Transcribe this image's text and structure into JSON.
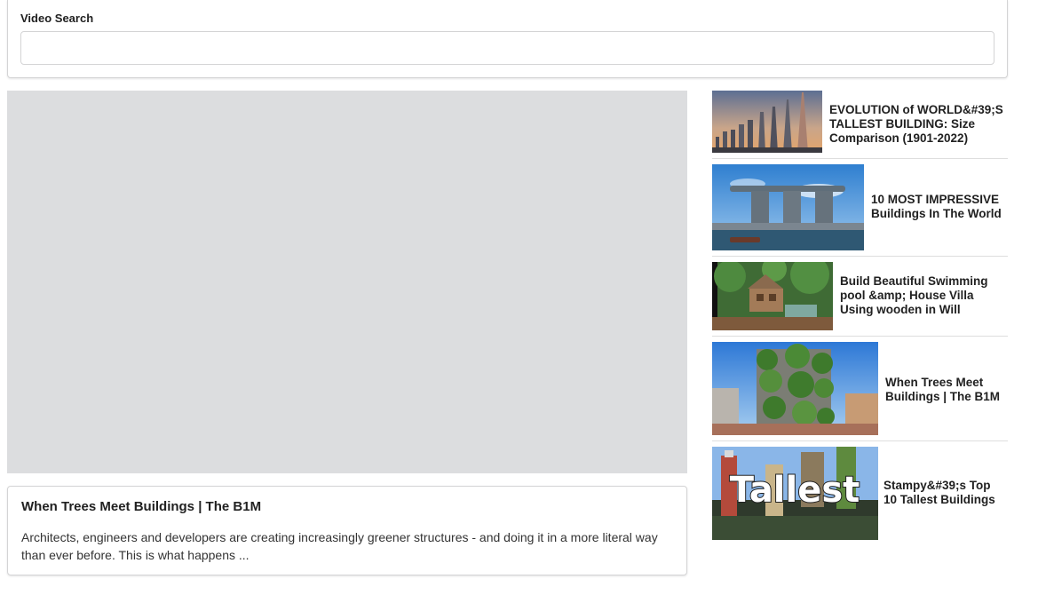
{
  "search": {
    "label": "Video Search",
    "value": "",
    "placeholder": ""
  },
  "selected_video": {
    "title": "When Trees Meet Buildings | The B1M",
    "description": "Architects, engineers and developers are creating increasingly greener structures - and doing it in a more literal way than ever before. This is what happens ..."
  },
  "video_list": [
    {
      "title": "EVOLUTION of WORLD&#39;S TALLEST BUILDING: Size Comparison (1901-2022)",
      "thumbnail": "skyscraper-comparison-thumbnail"
    },
    {
      "title": "10 MOST IMPRESSIVE Buildings In The World",
      "thumbnail": "marina-bay-sands-thumbnail"
    },
    {
      "title": "Build Beautiful Swimming pool &amp; House Villa Using wooden in Will",
      "thumbnail": "jungle-villa-thumbnail"
    },
    {
      "title": "When Trees Meet Buildings | The B1M",
      "thumbnail": "vertical-forest-thumbnail"
    },
    {
      "title": "Stampy&#39;s Top 10 Tallest Buildings",
      "thumbnail": "minecraft-tallest-thumbnail",
      "overlay_text": "Tallest"
    }
  ]
}
